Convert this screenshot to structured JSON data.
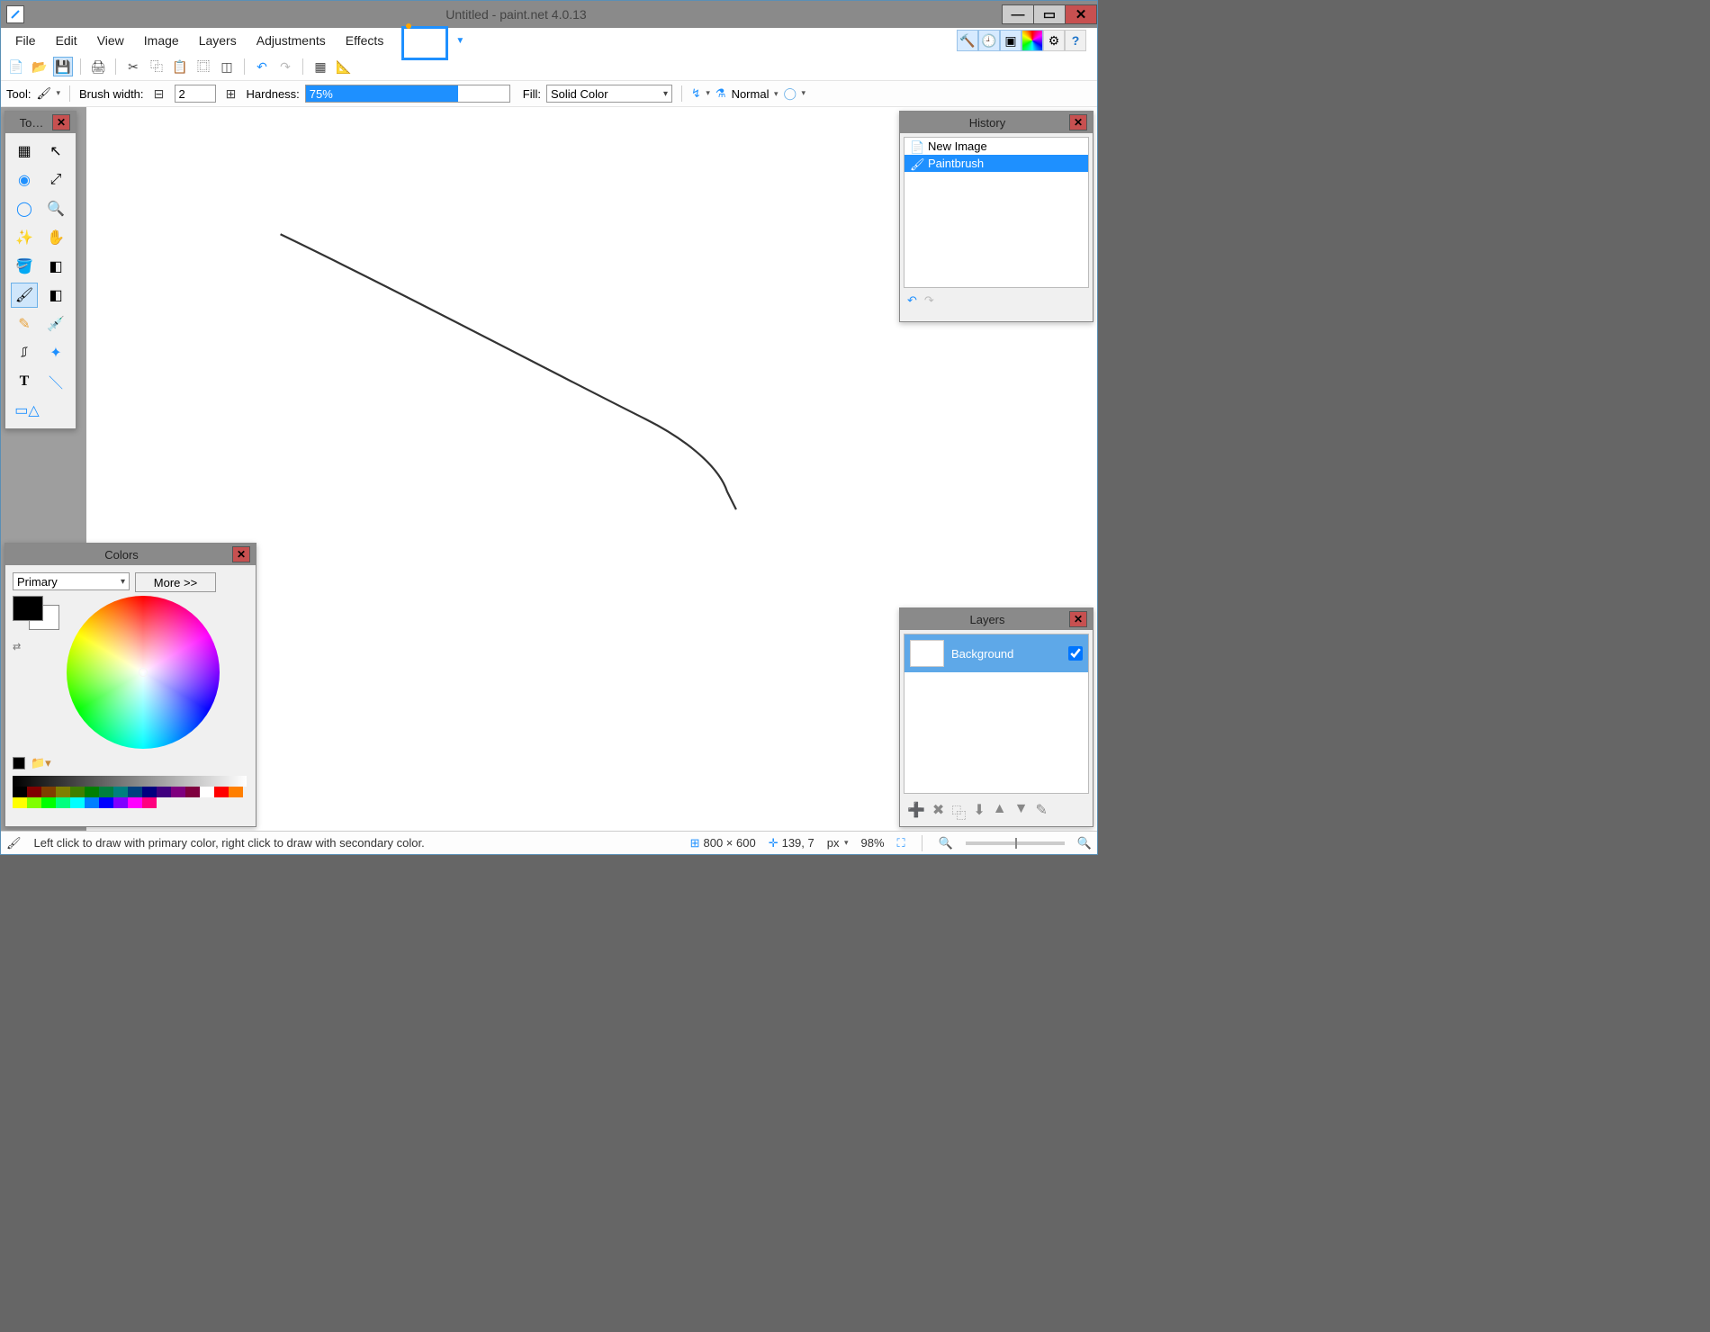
{
  "title": "Untitled - paint.net 4.0.13",
  "menubar": [
    "File",
    "Edit",
    "View",
    "Image",
    "Layers",
    "Adjustments",
    "Effects"
  ],
  "toolbar2": {
    "tool_label": "Tool:",
    "brush_label": "Brush width:",
    "brush_value": "2",
    "hardness_label": "Hardness:",
    "hardness_text": "75%",
    "hardness_pct": 75,
    "fill_label": "Fill:",
    "fill_value": "Solid Color",
    "blend_value": "Normal"
  },
  "tools_panel": {
    "title": "To…"
  },
  "history": {
    "title": "History",
    "items": [
      {
        "label": "New Image",
        "selected": false
      },
      {
        "label": "Paintbrush",
        "selected": true
      }
    ]
  },
  "colors": {
    "title": "Colors",
    "scope": "Primary",
    "more": "More >>"
  },
  "layers": {
    "title": "Layers",
    "items": [
      {
        "label": "Background",
        "checked": true
      }
    ]
  },
  "status": {
    "hint": "Left click to draw with primary color, right click to draw with secondary color.",
    "size": "800 × 600",
    "cursor": "139, 7",
    "unit": "px",
    "zoom": "98%"
  }
}
